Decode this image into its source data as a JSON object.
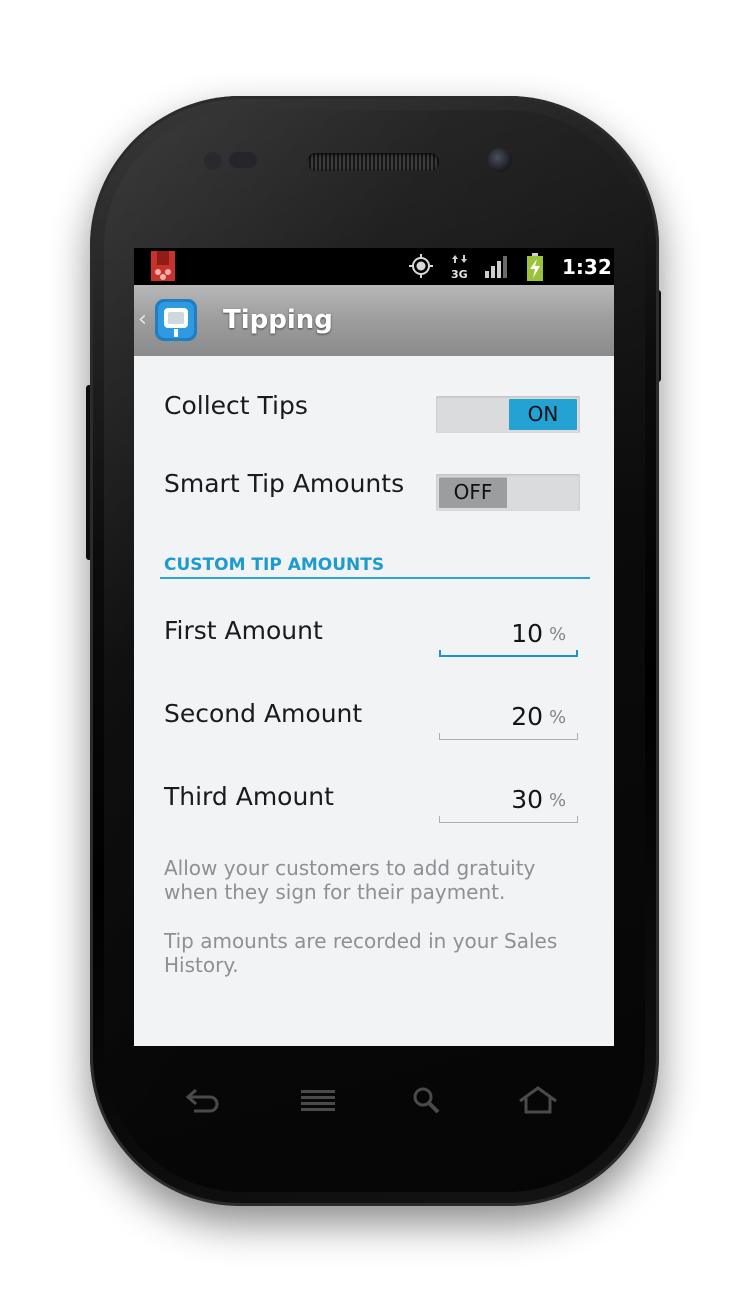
{
  "status_bar": {
    "time": "1:32",
    "icons": [
      "app-notification-icon",
      "gps-icon",
      "3g-data-icon",
      "signal-icon",
      "battery-charging-icon"
    ],
    "data_label": "3G"
  },
  "action_bar": {
    "back_glyph": "‹",
    "logo_icon": "square-app-logo-icon",
    "title": "Tipping"
  },
  "settings": {
    "collect_tips": {
      "label": "Collect Tips",
      "state": "ON",
      "on": true
    },
    "smart_tip_amounts": {
      "label": "Smart Tip Amounts",
      "state": "OFF",
      "on": false
    }
  },
  "custom_tip_amounts": {
    "header": "CUSTOM TIP AMOUNTS",
    "amounts": [
      {
        "label": "First Amount",
        "value": "10",
        "unit": "%",
        "focused": true
      },
      {
        "label": "Second Amount",
        "value": "20",
        "unit": "%",
        "focused": false
      },
      {
        "label": "Third Amount",
        "value": "30",
        "unit": "%",
        "focused": false
      }
    ]
  },
  "help_text": [
    "Allow your customers to add gratuity when they sign for their payment.",
    "Tip amounts are recorded in your Sales History."
  ],
  "nav_keys": [
    "back-key-icon",
    "menu-key-icon",
    "search-key-icon",
    "home-key-icon"
  ],
  "colors": {
    "accent": "#23a2d3",
    "section_header": "#1d9bd1",
    "help_text": "#8d9095",
    "toggle_off_knob": "#9c9d9f"
  }
}
